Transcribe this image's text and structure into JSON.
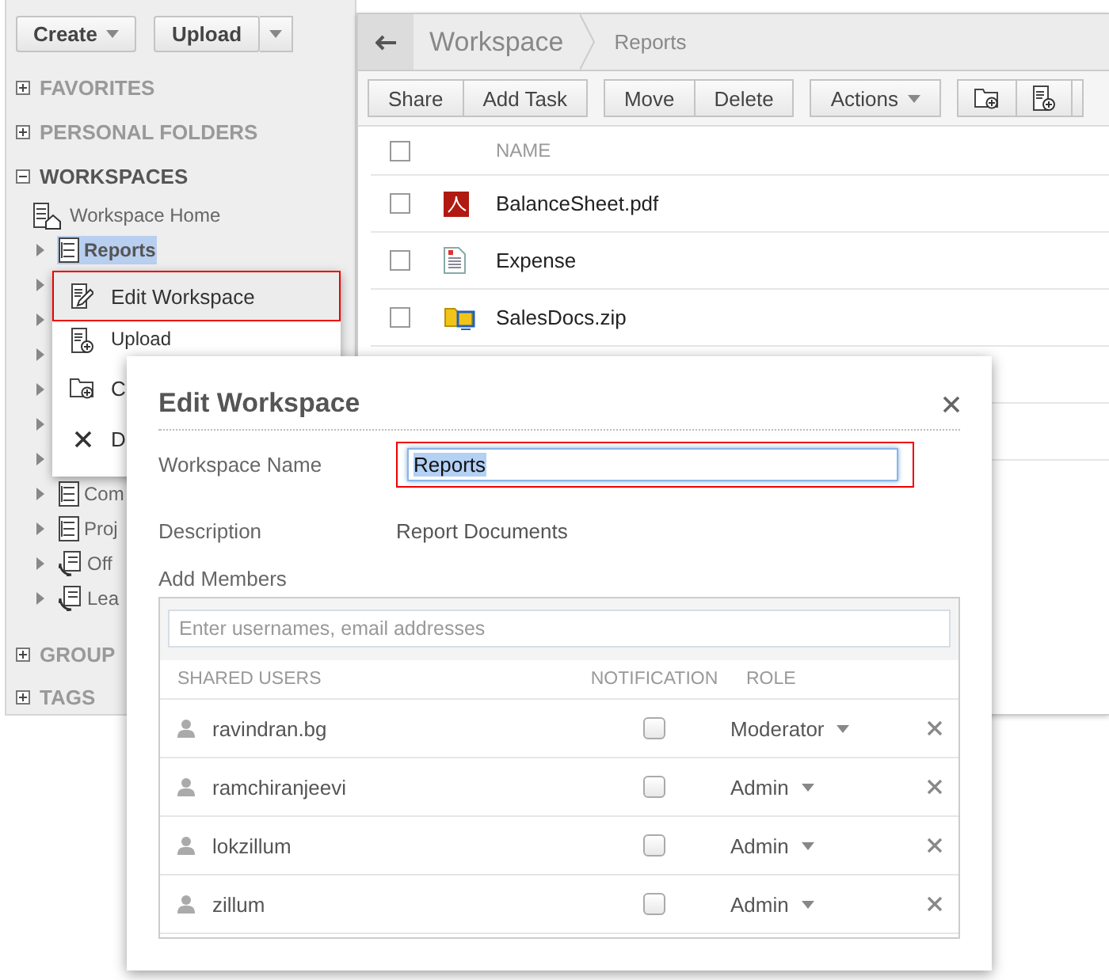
{
  "sidebar": {
    "buttons": [
      {
        "label": "Create",
        "kind": "menu"
      },
      {
        "label": "Upload",
        "kind": "split"
      }
    ],
    "sections": [
      {
        "label": "FAVORITES",
        "expanded": false
      },
      {
        "label": "PERSONAL FOLDERS",
        "expanded": false
      },
      {
        "label": "WORKSPACES",
        "expanded": true,
        "children": [
          {
            "label": "Workspace Home",
            "kind": "home"
          },
          {
            "label": "Reports",
            "kind": "workspace",
            "expanded": false,
            "selected": true
          },
          {
            "kind": "covered",
            "expanded": false
          },
          {
            "kind": "covered",
            "expanded": false
          },
          {
            "kind": "covered",
            "expanded": false
          },
          {
            "kind": "covered",
            "expanded": false
          },
          {
            "kind": "covered",
            "expanded": false
          },
          {
            "kind": "covered",
            "expanded": false
          },
          {
            "label": "Com",
            "kind": "workspace",
            "expanded": false,
            "selected": false
          },
          {
            "label": "Proj",
            "kind": "workspace",
            "expanded": false,
            "selected": false
          },
          {
            "label": "Off",
            "kind": "shared",
            "expanded": false,
            "selected": false
          },
          {
            "label": "Lea",
            "kind": "shared",
            "expanded": false,
            "selected": false
          }
        ]
      },
      {
        "label": "GROUP",
        "expanded": false
      },
      {
        "label": "TAGS",
        "expanded": false
      }
    ]
  },
  "breadcrumb": [
    {
      "label": "Workspace"
    },
    {
      "label": "Reports"
    }
  ],
  "toolbar": [
    {
      "buttons": [
        {
          "label": "Share"
        },
        {
          "label": "Add Task"
        }
      ]
    },
    {
      "buttons": [
        {
          "label": "Move"
        },
        {
          "label": "Delete"
        }
      ]
    },
    {
      "buttons": [
        {
          "label": "Actions",
          "kind": "menu"
        }
      ]
    },
    {
      "buttons": [
        {
          "kind": "new-folder"
        },
        {
          "kind": "new-file"
        },
        {
          "kind": "partial"
        }
      ]
    }
  ],
  "files": {
    "all_checked": false,
    "columns": [
      "NAME"
    ],
    "rows": [
      {
        "name": "BalanceSheet.pdf",
        "kind": "pdf",
        "checked": false
      },
      {
        "name": "Expense",
        "kind": "doc",
        "checked": false
      },
      {
        "name": "SalesDocs.zip",
        "kind": "zip",
        "checked": false
      }
    ]
  },
  "context_menu": [
    {
      "label": "Edit Workspace",
      "kind": "edit",
      "selected": true
    },
    {
      "label": "Upload",
      "kind": "upload",
      "selected": false
    },
    {
      "label": "C",
      "kind": "new-folder",
      "selected": false
    },
    {
      "label": "D",
      "kind": "delete",
      "selected": false
    }
  ],
  "dialog": {
    "title": "Edit Workspace",
    "fields": [
      {
        "label": "Workspace Name",
        "kind": "input",
        "value": "Reports",
        "annotated": true
      },
      {
        "label": "Description",
        "kind": "text",
        "value": "Report Documents",
        "annotated": false
      }
    ],
    "members": {
      "label": "Add Members",
      "placeholder": "Enter usernames, email addresses",
      "columns": [
        "SHARED USERS",
        "NOTIFICATION",
        "ROLE"
      ],
      "rows": [
        {
          "user": "ravindran.bg",
          "notification": false,
          "role": "Moderator"
        },
        {
          "user": "ramchiranjeevi",
          "notification": false,
          "role": "Admin"
        },
        {
          "user": "lokzillum",
          "notification": false,
          "role": "Admin"
        },
        {
          "user": "zillum",
          "notification": false,
          "role": "Admin"
        }
      ]
    }
  }
}
